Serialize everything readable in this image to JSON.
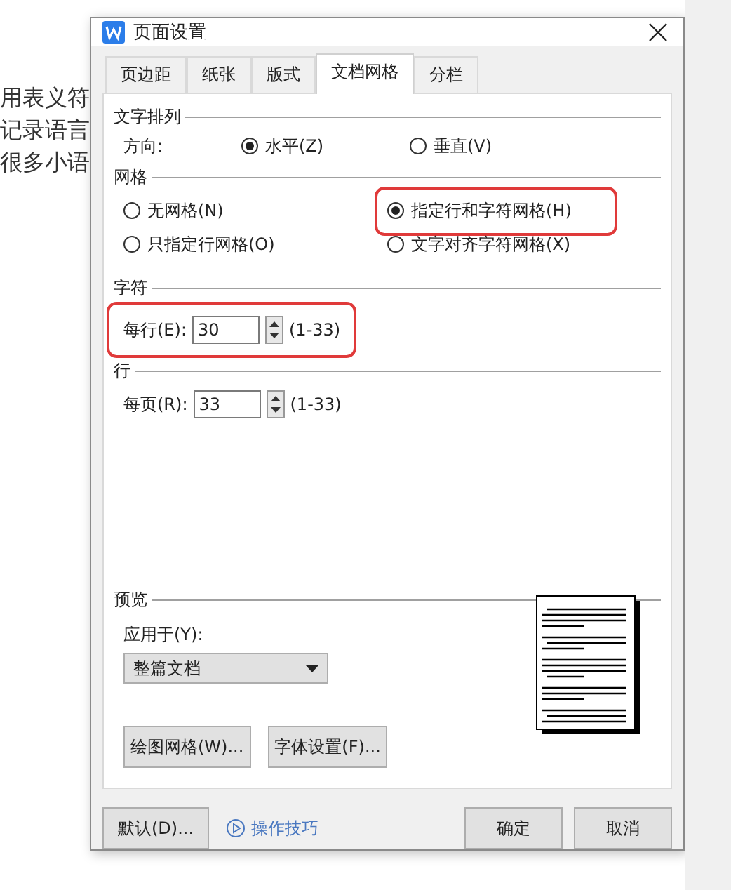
{
  "background_text": [
    "用表义符",
    "记录语言",
    "很多小语"
  ],
  "window": {
    "title": "页面设置"
  },
  "tabs": [
    {
      "label": "页边距",
      "selected": false
    },
    {
      "label": "纸张",
      "selected": false
    },
    {
      "label": "版式",
      "selected": false
    },
    {
      "label": "文档网格",
      "selected": true
    },
    {
      "label": "分栏",
      "selected": false
    }
  ],
  "text_arrangement": {
    "heading": "文字排列",
    "label": "方向:",
    "options": [
      {
        "label": "水平(Z)",
        "selected": true
      },
      {
        "label": "垂直(V)",
        "selected": false
      }
    ]
  },
  "grid": {
    "heading": "网格",
    "options": [
      {
        "label": "无网格(N)",
        "selected": false,
        "highlighted": false
      },
      {
        "label": "指定行和字符网格(H)",
        "selected": true,
        "highlighted": true
      },
      {
        "label": "只指定行网格(O)",
        "selected": false,
        "highlighted": false
      },
      {
        "label": "文字对齐字符网格(X)",
        "selected": false,
        "highlighted": false
      }
    ]
  },
  "characters": {
    "heading": "字符",
    "label": "每行(E):",
    "value": "30",
    "range": "(1-33)",
    "highlighted": true
  },
  "lines": {
    "heading": "行",
    "label": "每页(R):",
    "value": "33",
    "range": "(1-33)"
  },
  "preview": {
    "heading": "预览",
    "apply_label": "应用于(Y):",
    "apply_value": "整篇文档"
  },
  "panel_buttons": [
    "绘图网格(W)...",
    "字体设置(F)..."
  ],
  "footer": {
    "default_button": "默认(D)...",
    "tips_link": "操作技巧",
    "ok_button": "确定",
    "cancel_button": "取消"
  }
}
